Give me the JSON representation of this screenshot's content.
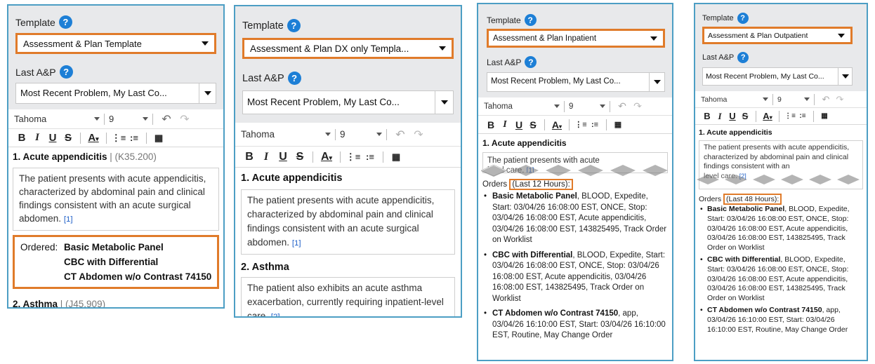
{
  "common": {
    "template_label": "Template",
    "last_ap_label": "Last A&P",
    "help_glyph": "?",
    "last_ap_value": "Most Recent Problem, My Last Co...",
    "font_name": "Tahoma",
    "font_size": "9",
    "problem1_title": "1. Acute appendicitis",
    "problem2_title": "2. Asthma",
    "ref1": "[1]",
    "ref2": "[2]",
    "icons": [
      "help-icon",
      "undo-icon",
      "redo-icon",
      "bold-icon",
      "italic-icon",
      "underline-icon",
      "strikethrough-icon",
      "font-color-icon",
      "numbered-list-icon",
      "bulleted-list-icon",
      "insert-table-icon"
    ],
    "colors": {
      "accent_border": "#4c9ec4",
      "highlight": "#e07b2a",
      "help_blue": "#1d7fd6",
      "link_blue": "#1d5ec7"
    }
  },
  "panel1": {
    "template_value": "Assessment & Plan Template",
    "problem1_code": " | (K35.200)",
    "problem1_text": "The patient presents with acute appendicitis, characterized by abdominal pain and clinical findings consistent with an acute surgical abdomen.",
    "ordered_label": "Ordered:",
    "ordered_items": [
      "Basic Metabolic Panel",
      "CBC with Differential",
      "CT Abdomen w/o Contrast 74150"
    ],
    "problem2_code": " | (J45.909)"
  },
  "panel2": {
    "template_value": "Assessment & Plan DX only Templa...",
    "problem1_text": "The patient presents with acute appendicitis, characterized by abdominal pain and clinical findings consistent with an acute surgical abdomen.",
    "problem2_text": "The patient also exhibits an acute asthma exacerbation, currently requiring inpatient-level care."
  },
  "panel3": {
    "template_value": "Assessment & Plan Inpatient",
    "problem1_text_fragment_1": "The patient presents with acute",
    "problem1_text_fragment_2": "level care.",
    "orders_prefix": "Orders",
    "orders_range": "(Last 12 Hours):",
    "orders": [
      {
        "name": "Basic Metabolic Panel",
        "detail": ", BLOOD, Expedite, Start: 03/04/26 16:08:00 EST, ONCE, Stop: 03/04/26 16:08:00 EST, Acute appendicitis, 03/04/26 16:08:00 EST, 143825495, Track Order on Worklist"
      },
      {
        "name": "CBC with Differential",
        "detail": ", BLOOD, Expedite, Start: 03/04/26 16:08:00 EST, ONCE, Stop: 03/04/26 16:08:00 EST, Acute appendicitis, 03/04/26 16:08:00 EST, 143825495, Track Order on Worklist"
      },
      {
        "name": "CT Abdomen w/o Contrast 74150",
        "detail": ", app, 03/04/26 16:10:00 EST, Start: 03/04/26 16:10:00 EST, Routine, May Change Order"
      }
    ]
  },
  "panel4": {
    "template_value": "Assessment & Plan Outpatient",
    "problem1_text": "The patient presents with acute appendicitis, characterized by abdominal pain and clinical findings consistent with an",
    "problem1_text_fragment_2": "level care.",
    "orders_prefix": "Orders",
    "orders_range": "(Last 48 Hours):",
    "orders": [
      {
        "name": "Basic Metabolic Panel",
        "detail": ", BLOOD, Expedite, Start: 03/04/26 16:08:00 EST, ONCE, Stop: 03/04/26 16:08:00 EST, Acute appendicitis, 03/04/26 16:08:00 EST, 143825495, Track Order on Worklist"
      },
      {
        "name": "CBC with Differential",
        "detail": ", BLOOD, Expedite, Start: 03/04/26 16:08:00 EST, ONCE, Stop: 03/04/26 16:08:00 EST, Acute appendicitis, 03/04/26 16:08:00 EST, 143825495, Track Order on Worklist"
      },
      {
        "name": "CT Abdomen w/o Contrast 74150",
        "detail": ", app, 03/04/26 16:10:00 EST, Start: 03/04/26 16:10:00 EST, Routine, May Change Order"
      }
    ]
  }
}
